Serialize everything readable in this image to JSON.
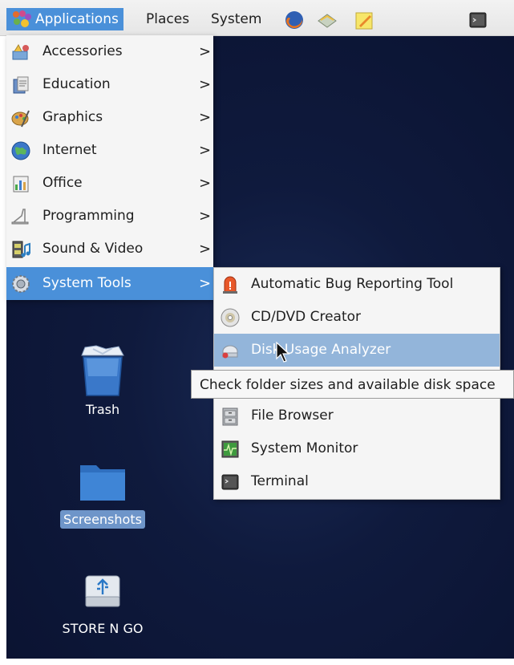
{
  "panel": {
    "applications_label": "Applications",
    "places_label": "Places",
    "system_label": "System"
  },
  "menu": {
    "items": [
      {
        "label": "Accessories",
        "icon": "accessories-icon"
      },
      {
        "label": "Education",
        "icon": "education-icon"
      },
      {
        "label": "Graphics",
        "icon": "graphics-icon"
      },
      {
        "label": "Internet",
        "icon": "internet-icon"
      },
      {
        "label": "Office",
        "icon": "office-icon"
      },
      {
        "label": "Programming",
        "icon": "programming-icon"
      },
      {
        "label": "Sound & Video",
        "icon": "sound-video-icon"
      },
      {
        "label": "System Tools",
        "icon": "system-tools-icon"
      }
    ],
    "arrow": ">"
  },
  "submenu": {
    "items": [
      {
        "label": "Automatic Bug Reporting Tool"
      },
      {
        "label": "CD/DVD Creator"
      },
      {
        "label": "Disk Usage Analyzer"
      },
      {
        "label": ""
      },
      {
        "label": "File Browser"
      },
      {
        "label": "System Monitor"
      },
      {
        "label": "Terminal"
      }
    ]
  },
  "tooltip": {
    "text": "Check folder sizes and available disk space"
  },
  "desktop": {
    "trash_label": "Trash",
    "screenshots_label": "Screenshots",
    "usb_label": "STORE N GO"
  },
  "colors": {
    "selection": "#4a90d9",
    "hover": "#93b5da",
    "desktop": "#0f1a3d"
  }
}
